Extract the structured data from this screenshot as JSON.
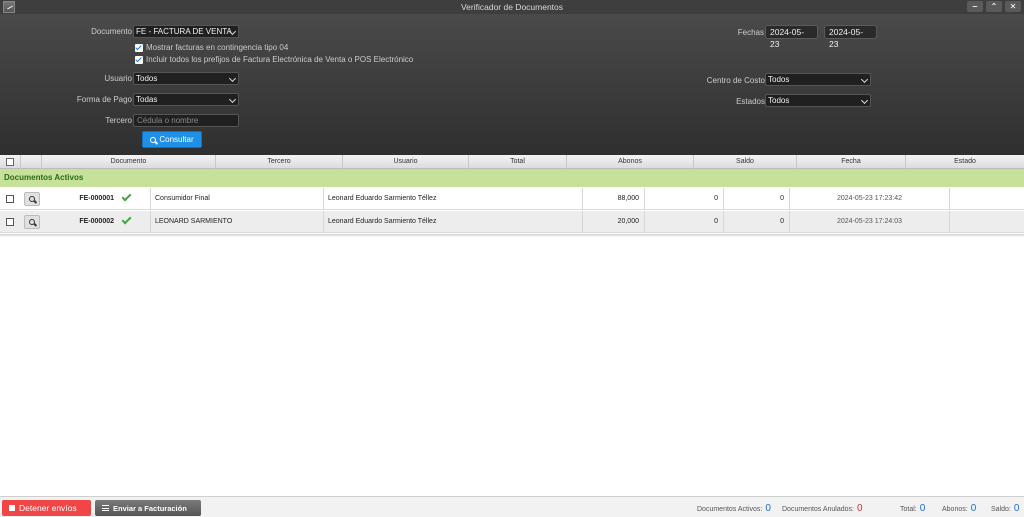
{
  "window": {
    "title": "Verificador de Documentos",
    "btn_min": "‒",
    "btn_max": "⌃",
    "btn_close": "✕"
  },
  "filters": {
    "documento_label": "Documento",
    "documento_value": "FE - FACTURA DE VENTA",
    "chk_contingencia": "Mostrar facturas en contingencia tipo 04",
    "chk_prefijos": "Incluir todos los prefijos de Factura Electrónica de Venta o POS Electrónico",
    "usuario_label": "Usuario",
    "usuario_value": "Todos",
    "forma_pago_label": "Forma de Pago",
    "forma_pago_value": "Todas",
    "tercero_label": "Tercero",
    "tercero_placeholder": "Cédula o nombre",
    "consultar_label": "Consultar",
    "fechas_label": "Fechas",
    "fecha_desde": "2024-05-23",
    "fecha_hasta": "2024-05-23",
    "centro_costo_label": "Centro de Costo",
    "centro_costo_value": "Todos",
    "estados_label": "Estados",
    "estados_value": "Todos"
  },
  "table": {
    "columns": [
      "Documento",
      "Tercero",
      "Usuario",
      "Total",
      "Abonos",
      "Saldo",
      "Fecha",
      "Estado"
    ],
    "group_label": "Documentos Activos",
    "rows": [
      {
        "documento": "FE-000001",
        "tercero": "Consumidor Final",
        "usuario": "Leonard Eduardo Sarmiento Téllez",
        "total": "88,000",
        "abonos": "0",
        "saldo": "0",
        "fecha": "2024-05-23 17:23:42",
        "estado": ""
      },
      {
        "documento": "FE-000002",
        "tercero": "LEONARD SARMIENTO",
        "usuario": "Leonard Eduardo Sarmiento Téllez",
        "total": "20,000",
        "abonos": "0",
        "saldo": "0",
        "fecha": "2024-05-23 17:24:03",
        "estado": ""
      }
    ]
  },
  "footer": {
    "stop_label": "Detener envíos",
    "send_label": "Enviar a Facturación",
    "activos_label": "Documentos Activos:",
    "activos_value": "0",
    "anulados_label": "Documentos Anulados:",
    "anulados_value": "0",
    "total_label": "Total:",
    "total_value": "0",
    "abonos_label": "Abonos:",
    "abonos_value": "0",
    "saldo_label": "Saldo:",
    "saldo_value": "0"
  },
  "colors": {
    "accent": "#1e90e8",
    "group_bg": "#c6e29a",
    "stop": "#f04646",
    "ok": "#41a63a"
  },
  "icons": [
    "app-icon",
    "minimize-icon",
    "maximize-icon",
    "close-icon",
    "chevron-down-icon",
    "check-icon",
    "search-icon",
    "stop-icon",
    "list-icon"
  ]
}
